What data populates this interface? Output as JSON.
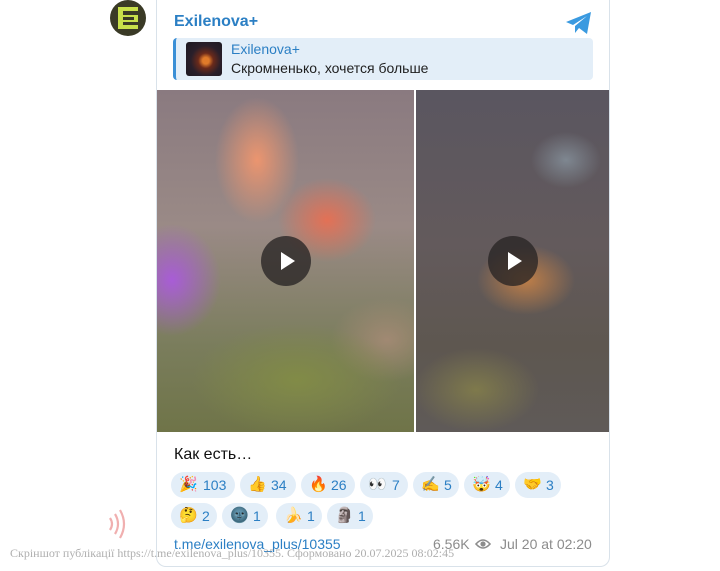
{
  "channel": {
    "name": "Exilenova+",
    "avatar_icon": "exilenova-logo",
    "avatar_bg": "#3a3a26",
    "logo_color": "#c8e04a"
  },
  "reply": {
    "title": "Exilenova+",
    "text": "Скромненько, хочется больше"
  },
  "media": [
    {
      "type": "video",
      "icon": "play-icon"
    },
    {
      "type": "video",
      "icon": "play-icon"
    }
  ],
  "post": {
    "caption": "Как есть…",
    "link": "t.me/exilenova_plus/10355",
    "views": "6.56K",
    "date": "Jul 20 at 02:20"
  },
  "reactions": [
    {
      "emoji": "🎉",
      "count": "103"
    },
    {
      "emoji": "👍",
      "count": "34"
    },
    {
      "emoji": "🔥",
      "count": "26"
    },
    {
      "emoji": "👀",
      "count": "7"
    },
    {
      "emoji": "✍️",
      "count": "5"
    },
    {
      "emoji": "🤯",
      "count": "4"
    },
    {
      "emoji": "🤝",
      "count": "3"
    },
    {
      "emoji": "🤔",
      "count": "2"
    },
    {
      "emoji": "🌚",
      "count": "1"
    },
    {
      "emoji": "🍌",
      "count": "1"
    },
    {
      "emoji": "🗿",
      "count": "1"
    }
  ],
  "watermark": "Скріншот публікації https://t.me/exilenova_plus/10355. Сформовано 20.07.2025 08:02:45",
  "colors": {
    "accent": "#2b7fc4",
    "reaction_bg": "#e3eef8",
    "telegram_icon": "#3a9ae0"
  }
}
